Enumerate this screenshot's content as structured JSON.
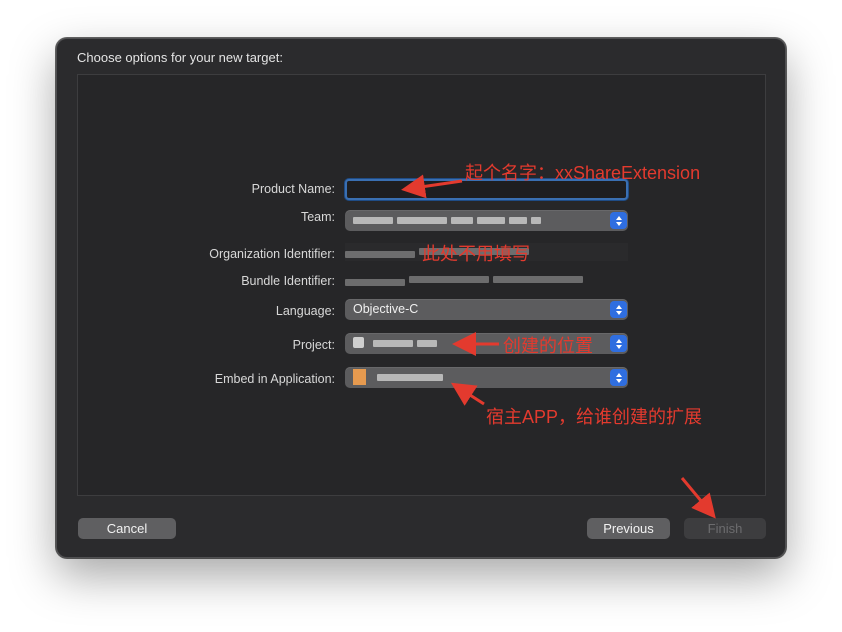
{
  "dialog": {
    "title": "Choose options for your new target:"
  },
  "form": {
    "product_name": {
      "label": "Product Name:",
      "value": ""
    },
    "team": {
      "label": "Team:"
    },
    "organization_identifier": {
      "label": "Organization Identifier:"
    },
    "bundle_identifier": {
      "label": "Bundle Identifier:"
    },
    "language": {
      "label": "Language:",
      "value": "Objective-C"
    },
    "project": {
      "label": "Project:"
    },
    "embed_in_application": {
      "label": "Embed in Application:"
    }
  },
  "buttons": {
    "cancel": "Cancel",
    "previous": "Previous",
    "finish": "Finish"
  },
  "annotations": {
    "product_name_note": "起个名字：xxShareExtension",
    "org_id_note": "此处不用填写",
    "project_note": "创建的位置",
    "embed_note": "宿主APP，给谁创建的扩展"
  },
  "colors": {
    "annotation": "#e33a2e",
    "accent": "#2f6ee0",
    "dialog_bg": "#2b2b2d"
  }
}
